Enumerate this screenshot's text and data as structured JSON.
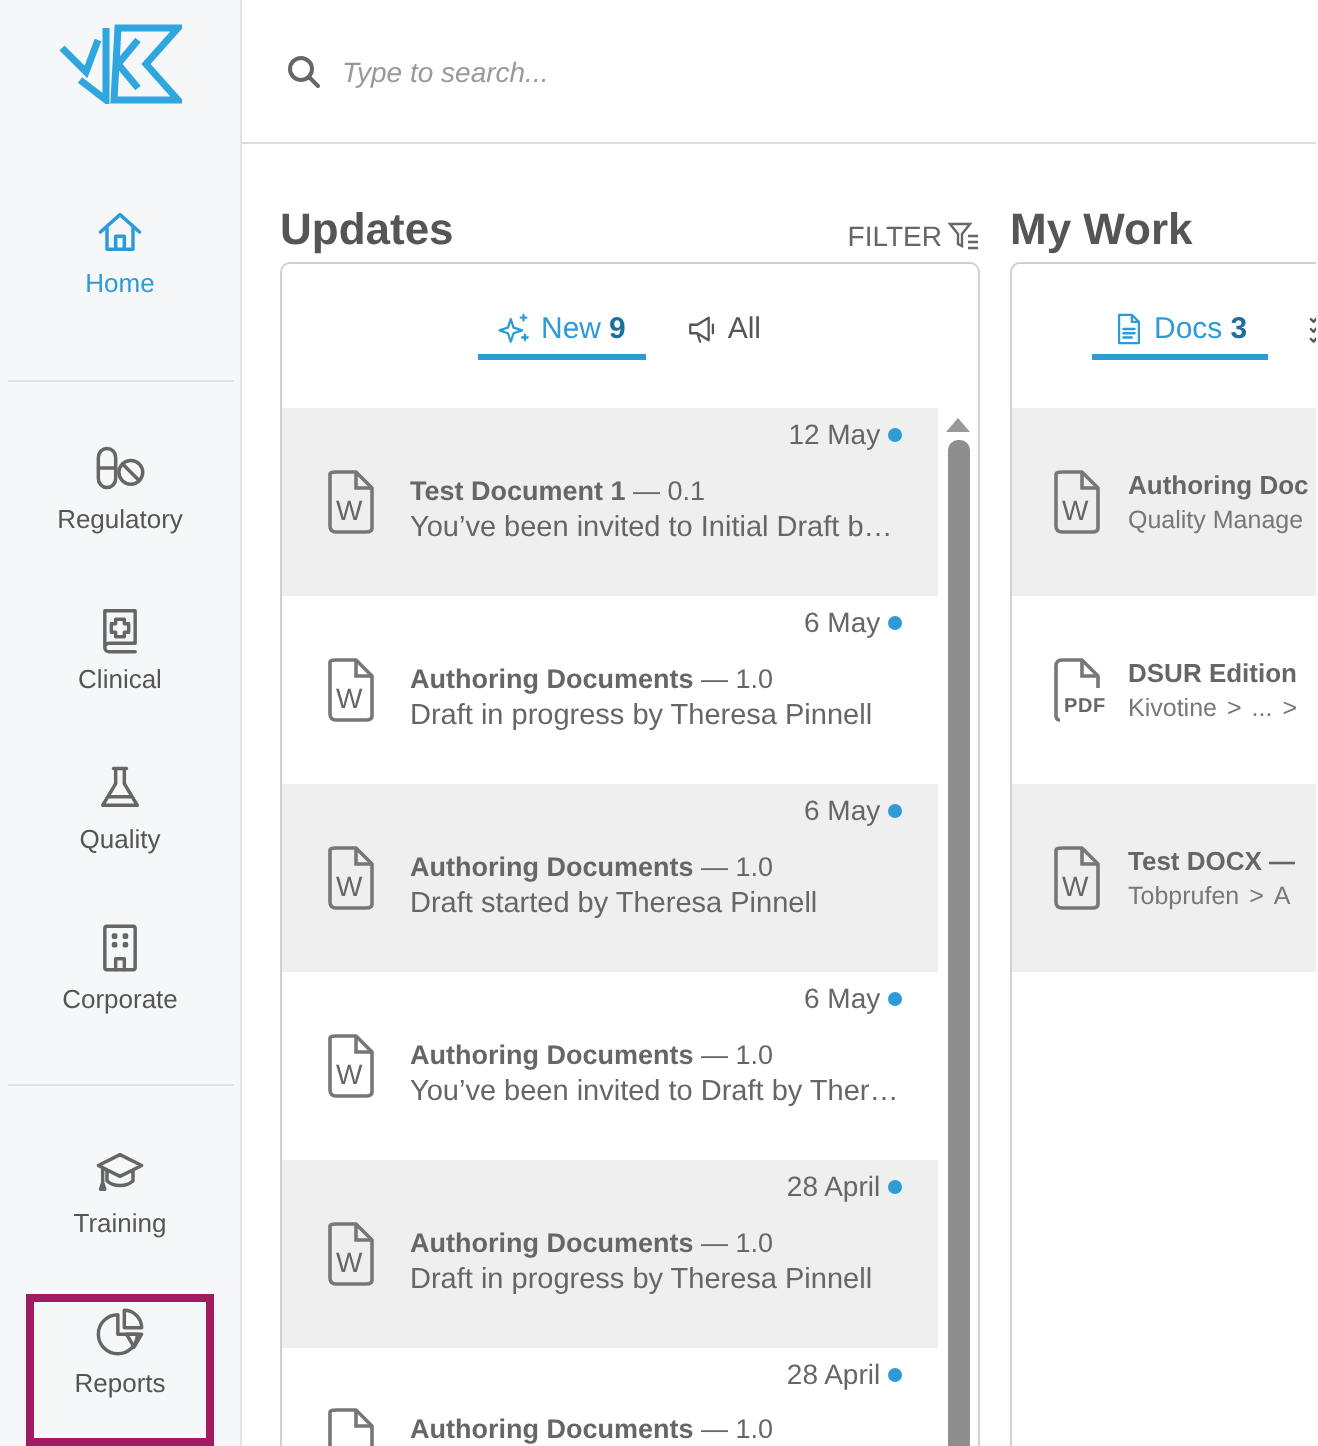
{
  "sidebar": {
    "items": [
      {
        "label": "Home",
        "selected": true,
        "highlighted": false
      },
      {
        "label": "Regulatory",
        "selected": false,
        "highlighted": false
      },
      {
        "label": "Clinical",
        "selected": false,
        "highlighted": false
      },
      {
        "label": "Quality",
        "selected": false,
        "highlighted": false
      },
      {
        "label": "Corporate",
        "selected": false,
        "highlighted": false
      },
      {
        "label": "Training",
        "selected": false,
        "highlighted": false
      },
      {
        "label": "Reports",
        "selected": false,
        "highlighted": true
      }
    ]
  },
  "search": {
    "placeholder": "Type to search..."
  },
  "updates": {
    "title": "Updates",
    "filter": "FILTER",
    "tabs": [
      {
        "label": "New",
        "count": "9",
        "selected": true
      },
      {
        "label": "All",
        "selected": false
      }
    ],
    "items": [
      {
        "date": "12 May",
        "unread": true,
        "file_label": "W",
        "title": "**Test Document 1** — 0.1",
        "message": "You’ve been invited to Initial Draft b…"
      },
      {
        "date": "6 May",
        "unread": true,
        "file_label": "W",
        "title": "**Authoring Documents** — 1.0",
        "message": "Draft in progress by Theresa Pinnell"
      },
      {
        "date": "6 May",
        "unread": true,
        "file_label": "W",
        "title": "**Authoring Documents** — 1.0",
        "message": "Draft started by Theresa Pinnell"
      },
      {
        "date": "6 May",
        "unread": true,
        "file_label": "W",
        "title": "**Authoring Documents** — 1.0",
        "message": "You’ve been invited to Draft by Ther…"
      },
      {
        "date": "28 April",
        "unread": true,
        "file_label": "W",
        "title": "**Authoring Documents** — 1.0",
        "message": "Draft in progress by Theresa Pinnell"
      },
      {
        "date": "28 April",
        "unread": true,
        "title": "**Authoring Documents** — 1.0"
      }
    ]
  },
  "my_work": {
    "title": "My Work",
    "tabs": [
      {
        "label": "Docs",
        "count": "3",
        "selected": true
      },
      {
        "selected": false
      }
    ],
    "docs": [
      {
        "file_label": "W",
        "title": "Authoring Doc",
        "path": [
          "Quality Manage"
        ]
      },
      {
        "file_label": "PDF",
        "title": "DSUR Edition",
        "path": [
          "Kivotine",
          ">",
          "...",
          ">"
        ]
      },
      {
        "file_label": "W",
        "title": "Test DOCX —",
        "path": [
          "Tobprufen",
          ">",
          "A"
        ]
      }
    ]
  }
}
